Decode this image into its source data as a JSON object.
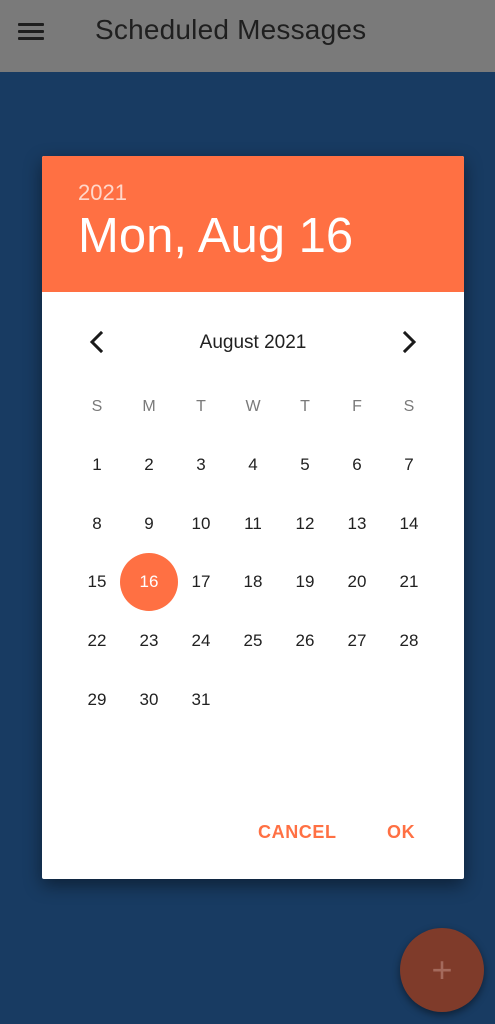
{
  "app_bar": {
    "title": "Scheduled Messages",
    "menu_icon": "hamburger-menu-icon",
    "background": "#7a7a7a"
  },
  "colors": {
    "accent": "#ff7043",
    "background": "#183b62",
    "fab_dimmed": "#7f3b2a"
  },
  "date_picker": {
    "header": {
      "year": "2021",
      "date": "Mon, Aug 16"
    },
    "month_label": "August 2021",
    "prev_icon": "chevron-left-icon",
    "next_icon": "chevron-right-icon",
    "weekdays": [
      "S",
      "M",
      "T",
      "W",
      "T",
      "F",
      "S"
    ],
    "first_weekday_offset": 0,
    "days": [
      "1",
      "2",
      "3",
      "4",
      "5",
      "6",
      "7",
      "8",
      "9",
      "10",
      "11",
      "12",
      "13",
      "14",
      "15",
      "16",
      "17",
      "18",
      "19",
      "20",
      "21",
      "22",
      "23",
      "24",
      "25",
      "26",
      "27",
      "28",
      "29",
      "30",
      "31"
    ],
    "selected_day": "16",
    "cancel_label": "CANCEL",
    "ok_label": "OK"
  },
  "fab": {
    "icon": "plus-icon",
    "symbol": "+"
  }
}
